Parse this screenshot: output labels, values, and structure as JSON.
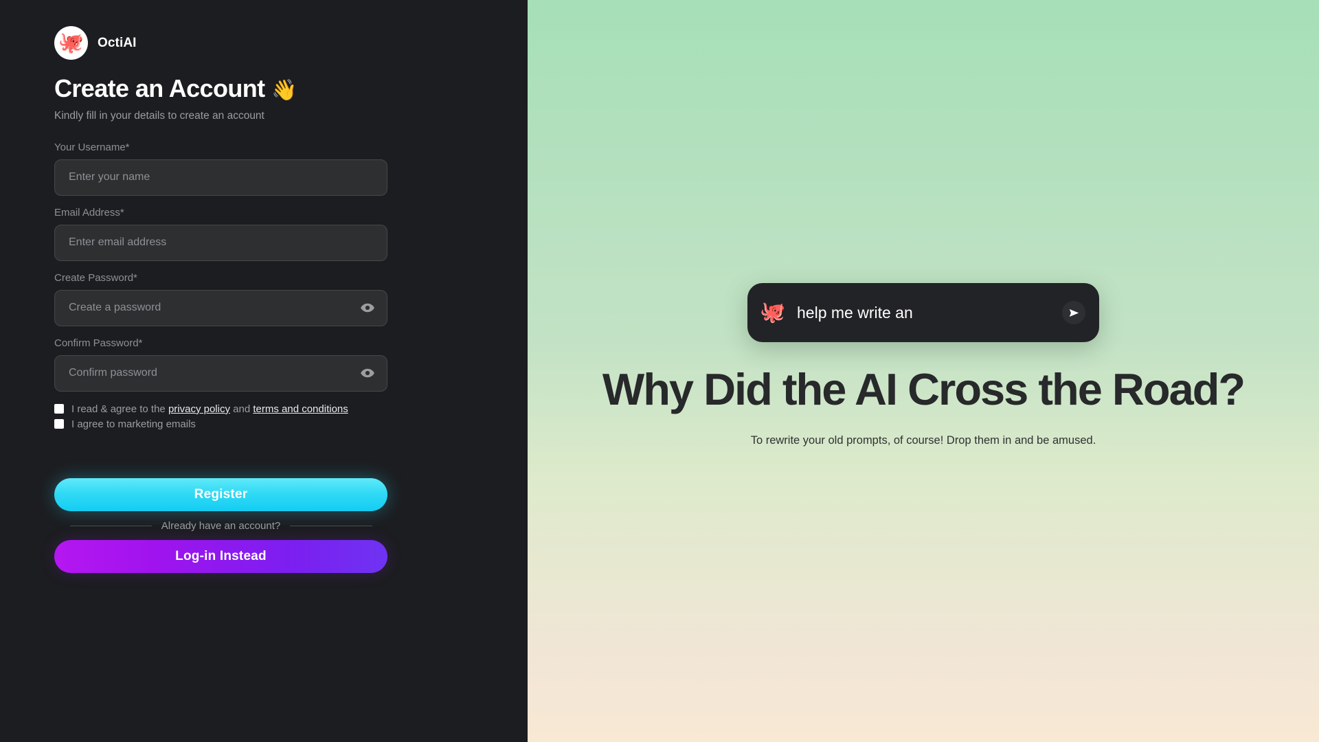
{
  "brand": {
    "name": "OctiAI",
    "logo_icon": "octopus-icon",
    "logo_glyph": "🐙"
  },
  "auth": {
    "title": "Create an Account",
    "title_emoji": "👋",
    "subtitle": "Kindly fill in your details to create an account",
    "fields": [
      {
        "label": "Your Username*",
        "placeholder": "Enter your name",
        "value": "",
        "type": "text",
        "has_toggle": false
      },
      {
        "label": "Email Address*",
        "placeholder": "Enter email address",
        "value": "",
        "type": "text",
        "has_toggle": false
      },
      {
        "label": "Create Password*",
        "placeholder": "Create a password",
        "value": "",
        "type": "password",
        "has_toggle": true
      },
      {
        "label": "Confirm Password*",
        "placeholder": "Confirm password",
        "value": "",
        "type": "password",
        "has_toggle": true
      }
    ],
    "toggle_icon": "eye-icon",
    "consent": {
      "terms": {
        "prefix": "I read & agree to the ",
        "link1": "privacy policy",
        "middle": " and ",
        "link2": "terms and conditions",
        "checked": false
      },
      "marketing": {
        "label": "I agree to marketing emails",
        "checked": false
      }
    },
    "register_label": "Register",
    "divider_text": "Already have an account?",
    "login_label": "Log-in Instead"
  },
  "promo": {
    "chat": {
      "avatar_icon": "octopus-icon",
      "avatar_glyph": "🐙",
      "text": "help me write an",
      "send_icon": "send-icon"
    },
    "headline": "Why Did the AI Cross the Road?",
    "subtitle": "To rewrite your old prompts, of course! Drop them in and be amused."
  },
  "colors": {
    "panel_bg": "#1c1d20",
    "input_bg": "#2e2f31",
    "register_accent": "#2fd9f5",
    "login_accent": "#a013ee",
    "promo_top": "#a6dfb8",
    "promo_bottom": "#f8e8d4"
  }
}
